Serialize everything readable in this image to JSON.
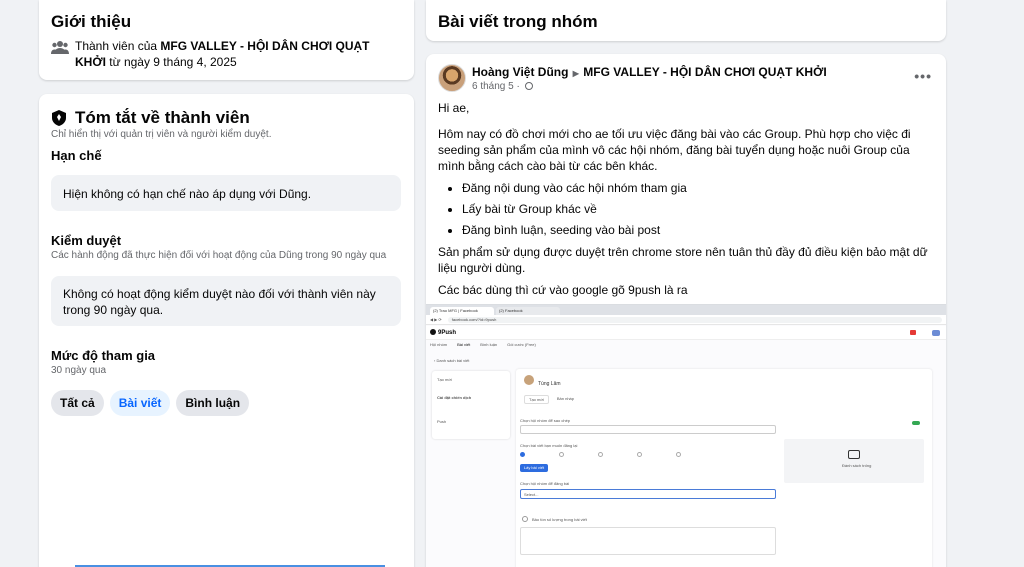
{
  "about": {
    "title": "Giới thiệu",
    "member_prefix": "Thành viên của ",
    "group_name": "MFG VALLEY - HỘI DÂN CHƠI QUẠT KHỞI",
    "member_suffix": " từ ngày 9 tháng 4, 2025"
  },
  "summary": {
    "title": "Tóm tắt về thành viên",
    "subtitle": "Chỉ hiển thị với quản trị viên và người kiểm duyệt.",
    "restriction_title": "Hạn chế",
    "restriction_text": "Hiện không có hạn chế nào áp dụng với Dũng.",
    "moderation_title": "Kiểm duyệt",
    "moderation_subtitle": "Các hành động đã thực hiện đối với hoạt động của Dũng trong 90 ngày qua",
    "moderation_text": "Không có hoạt động kiểm duyệt nào đối với thành viên này trong 90 ngày qua.",
    "engagement_title": "Mức độ tham gia",
    "engagement_subtitle": "30 ngày qua",
    "filters": [
      "Tất cả",
      "Bài viết",
      "Bình luận"
    ],
    "active_filter": 1
  },
  "posts": {
    "title": "Bài viết trong nhóm",
    "author": "Hoàng Việt Dũng",
    "group": "MFG VALLEY - HỘI DÂN CHƠI QUẠT KHỞI",
    "date": "6 tháng 5 ·",
    "more_icon": "more-horizontal-icon",
    "greeting": "Hi ae,",
    "intro": "Hôm nay có đồ chơi mới cho ae tối ưu việc đăng bài vào các Group. Phù hợp cho việc đi seeding sản phẩm của mình vô các hội nhóm, đăng bài tuyển dụng hoặc nuôi Group của mình bằng cách cào bài từ các bên khác.",
    "bullets": [
      "Đăng nội dung vào các hội nhóm tham gia",
      "Lấy bài từ Group khác về",
      "Đăng bình luận, seeding vào bài post"
    ],
    "note": "Sản phẩm sử dụng được duyệt trên chrome store nên tuân thủ đầy đủ điều kiện bảo mật dữ liệu người dùng.",
    "cta": "Các bác dùng thì cứ vào google gõ 9push là ra"
  },
  "embedded": {
    "tab1": "(2) Trao MFG | Facebook",
    "tab2": "(2) Facebook",
    "url": "facebook.com/?id=9push",
    "logo": "9Push",
    "nav": [
      "Hội nhóm",
      "Bài viết",
      "Bình luận",
      "Gói cước (Free)"
    ],
    "back": "Danh sách bài viết",
    "side_items": [
      "Tạo mới",
      "Cài đặt chiến dịch",
      "Push"
    ],
    "user": "Tùng Lâm",
    "tabs": [
      "Tạo mới",
      "Bản nháp"
    ],
    "field1": "Chọn hội nhóm để sao chép",
    "field2": "Chọn bài viết bạn muốn đăng lại",
    "field3": "Chọn hội nhóm để đăng bài",
    "select_placeholder": "Select...",
    "button": "Lấy bài viết",
    "checkbox": "Bảo tồn số lượng trong bài viết",
    "preview_label": "Đánh sách trống",
    "status": "Đã lên",
    "accent": "#2d6cdf"
  },
  "colors": {
    "bg": "#f0f2f5",
    "card": "#ffffff",
    "blue": "#0866ff",
    "pill_active_bg": "#e7f3ff"
  }
}
